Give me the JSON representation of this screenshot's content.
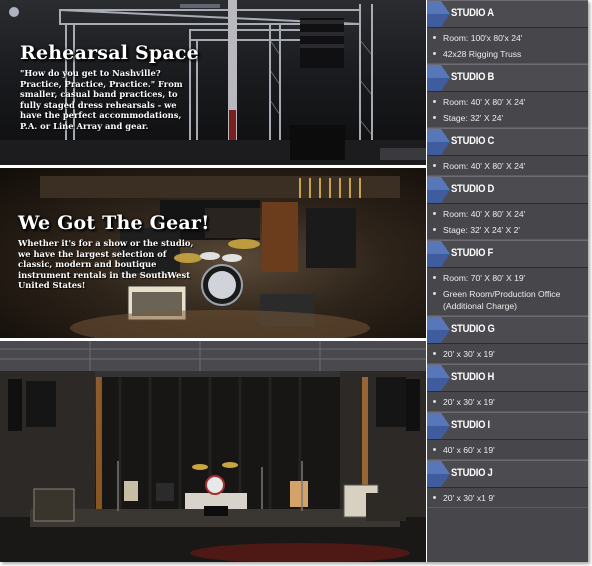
{
  "photos": {
    "rehearsal": {
      "title": "Rehearsal Space",
      "body": "\"How do you get to Nashville? Practice, Practice, Practice.\" From smaller, casual band practices, to fully staged dress rehearsals - we have the perfect accommodations, P.A. or Line Array and gear."
    },
    "gear": {
      "title": "We Got The Gear!",
      "body": "Whether it's for a show or the studio, we have the largest selection of classic, modern and boutique instrument rentals in the SouthWest United States!"
    },
    "stage": {}
  },
  "studios": [
    {
      "name": "STUDIO A",
      "details": [
        "Room: 100'x 80'x 24'",
        "42x28 Rigging Truss"
      ]
    },
    {
      "name": "STUDIO B",
      "details": [
        "Room: 40' X 80' X 24'",
        "Stage: 32' X 24'"
      ]
    },
    {
      "name": "STUDIO C",
      "details": [
        "Room: 40' X 80' X 24'"
      ]
    },
    {
      "name": "STUDIO D",
      "details": [
        "Room: 40' X 80' X 24'",
        "Stage: 32' X 24' X 2'"
      ]
    },
    {
      "name": "STUDIO F",
      "details": [
        "Room: 70' X 80' X 19'",
        "Green Room/Production Office (Additional Charge)"
      ]
    },
    {
      "name": "STUDIO G",
      "details": [
        "20' x 30' x 19'"
      ]
    },
    {
      "name": "STUDIO H",
      "details": [
        "20' x 30' x 19'"
      ]
    },
    {
      "name": "STUDIO I",
      "details": [
        "40' x 60' x 19'"
      ]
    },
    {
      "name": "STUDIO J",
      "details": [
        "20' x 30' x1 9'"
      ]
    }
  ],
  "colors": {
    "sidebar_bg": "#47474b",
    "tab_blue": "#3f5c9e",
    "text": "#ffffff"
  }
}
